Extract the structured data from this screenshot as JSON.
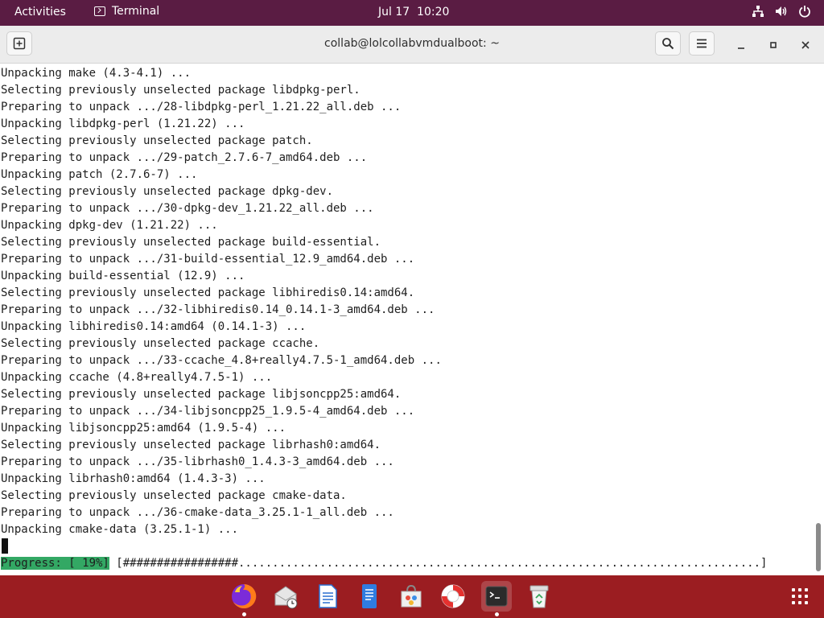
{
  "topbar": {
    "activities": "Activities",
    "app_name": "Terminal",
    "clock": "Jul 17  10:20"
  },
  "window": {
    "title": "collab@lolcollabvmdualboot: ~"
  },
  "terminal": {
    "lines": [
      "Unpacking make (4.3-4.1) ...",
      "Selecting previously unselected package libdpkg-perl.",
      "Preparing to unpack .../28-libdpkg-perl_1.21.22_all.deb ...",
      "Unpacking libdpkg-perl (1.21.22) ...",
      "Selecting previously unselected package patch.",
      "Preparing to unpack .../29-patch_2.7.6-7_amd64.deb ...",
      "Unpacking patch (2.7.6-7) ...",
      "Selecting previously unselected package dpkg-dev.",
      "Preparing to unpack .../30-dpkg-dev_1.21.22_all.deb ...",
      "Unpacking dpkg-dev (1.21.22) ...",
      "Selecting previously unselected package build-essential.",
      "Preparing to unpack .../31-build-essential_12.9_amd64.deb ...",
      "Unpacking build-essential (12.9) ...",
      "Selecting previously unselected package libhiredis0.14:amd64.",
      "Preparing to unpack .../32-libhiredis0.14_0.14.1-3_amd64.deb ...",
      "Unpacking libhiredis0.14:amd64 (0.14.1-3) ...",
      "Selecting previously unselected package ccache.",
      "Preparing to unpack .../33-ccache_4.8+really4.7.5-1_amd64.deb ...",
      "Unpacking ccache (4.8+really4.7.5-1) ...",
      "Selecting previously unselected package libjsoncpp25:amd64.",
      "Preparing to unpack .../34-libjsoncpp25_1.9.5-4_amd64.deb ...",
      "Unpacking libjsoncpp25:amd64 (1.9.5-4) ...",
      "Selecting previously unselected package librhash0:amd64.",
      "Preparing to unpack .../35-librhash0_1.4.3-3_amd64.deb ...",
      "Unpacking librhash0:amd64 (1.4.3-3) ...",
      "Selecting previously unselected package cmake-data.",
      "Preparing to unpack .../36-cmake-data_3.25.1-1_all.deb ...",
      "Unpacking cmake-data (3.25.1-1) ..."
    ],
    "progress_label": "Progress: [ 19%]",
    "progress_bar": " [#################.............................................................................]",
    "progress_percent": 19,
    "progress_color": "#33a864",
    "text_color": "#1e1e1e"
  },
  "colors": {
    "topbar_bg": "#5a1c43",
    "dock_bg": "#9b1d21"
  },
  "dock": {
    "items": [
      {
        "icon": "firefox-icon",
        "running": true
      },
      {
        "icon": "mail-clock-icon",
        "running": false
      },
      {
        "icon": "writer-document-icon",
        "running": false
      },
      {
        "icon": "text-editor-icon",
        "running": false
      },
      {
        "icon": "software-store-icon",
        "running": false
      },
      {
        "icon": "help-lifebuoy-icon",
        "running": false
      },
      {
        "icon": "terminal-icon",
        "running": true
      },
      {
        "icon": "trash-icon",
        "running": false
      }
    ],
    "apps_grid_icon": "show-apps-icon"
  }
}
